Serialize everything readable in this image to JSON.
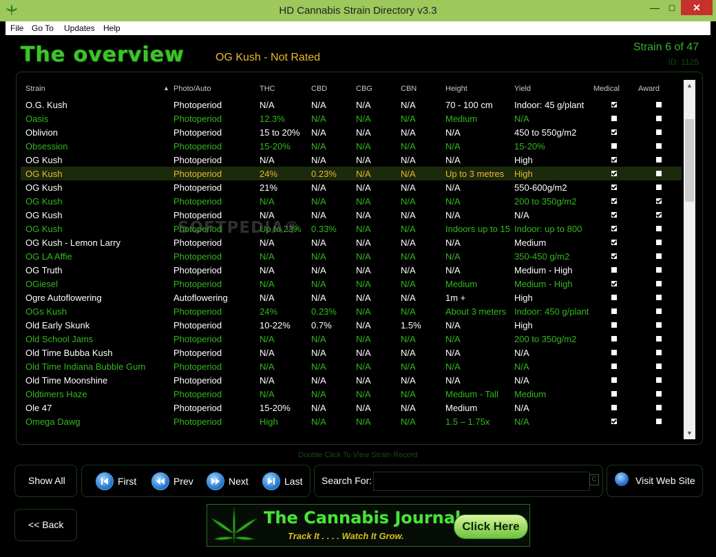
{
  "window": {
    "title": "HD Cannabis Strain Directory v3.3",
    "minimize": "—",
    "maximize": "□",
    "close": "✕"
  },
  "menu": [
    "File",
    "Go To",
    "Updates",
    "Help"
  ],
  "header": {
    "logo": "The overview",
    "selected_strain": "OG Kush - Not Rated",
    "counter": "Strain 6 of 47",
    "id": "ID: 1125"
  },
  "columns": [
    "Strain",
    "Photo/Auto",
    "THC",
    "CBD",
    "CBG",
    "CBN",
    "Height",
    "Yield",
    "Medical",
    "Award"
  ],
  "sort_indicator": "▲",
  "rows": [
    {
      "strain": "O.G. Kush",
      "photo": "Photoperiod",
      "thc": "N/A",
      "cbd": "N/A",
      "cbg": "N/A",
      "cbn": "N/A",
      "height": "70 - 100 cm",
      "yield": "Indoor: 45 g/plant",
      "medical": true,
      "award": false,
      "style": "white"
    },
    {
      "strain": "Oasis",
      "photo": "Photoperiod",
      "thc": "12.3%",
      "cbd": "N/A",
      "cbg": "N/A",
      "cbn": "N/A",
      "height": "Medium",
      "yield": "N/A",
      "medical": false,
      "award": false,
      "style": "green"
    },
    {
      "strain": "Oblivion",
      "photo": "Photoperiod",
      "thc": "15 to 20%",
      "cbd": "N/A",
      "cbg": "N/A",
      "cbn": "N/A",
      "height": "N/A",
      "yield": "450 to 550g/m2",
      "medical": true,
      "award": false,
      "style": "white"
    },
    {
      "strain": "Obsession",
      "photo": "Photoperiod",
      "thc": "15-20%",
      "cbd": "N/A",
      "cbg": "N/A",
      "cbn": "N/A",
      "height": "N/A",
      "yield": "15-20%",
      "medical": false,
      "award": false,
      "style": "green"
    },
    {
      "strain": "OG Kush",
      "photo": "Photoperiod",
      "thc": "N/A",
      "cbd": "N/A",
      "cbg": "N/A",
      "cbn": "N/A",
      "height": "N/A",
      "yield": "High",
      "medical": true,
      "award": false,
      "style": "white"
    },
    {
      "strain": "OG Kush",
      "photo": "Photoperiod",
      "thc": "24%",
      "cbd": "0.23%",
      "cbg": "N/A",
      "cbn": "N/A",
      "height": "Up to 3 metres",
      "yield": "High",
      "medical": true,
      "award": false,
      "style": "selected"
    },
    {
      "strain": "OG Kush",
      "photo": "Photoperiod",
      "thc": "21%",
      "cbd": "N/A",
      "cbg": "N/A",
      "cbn": "N/A",
      "height": "N/A",
      "yield": "550-600g/m2",
      "medical": true,
      "award": false,
      "style": "white"
    },
    {
      "strain": "OG Kush",
      "photo": "Photoperiod",
      "thc": "N/A",
      "cbd": "N/A",
      "cbg": "N/A",
      "cbn": "N/A",
      "height": "N/A",
      "yield": "200 to 350g/m2",
      "medical": true,
      "award": true,
      "style": "green"
    },
    {
      "strain": "OG Kush",
      "photo": "Photoperiod",
      "thc": "N/A",
      "cbd": "N/A",
      "cbg": "N/A",
      "cbn": "N/A",
      "height": "N/A",
      "yield": "N/A",
      "medical": true,
      "award": true,
      "style": "white"
    },
    {
      "strain": "OG Kush",
      "photo": "Photoperiod",
      "thc": "Up to 23%",
      "cbd": "0.33%",
      "cbg": "N/A",
      "cbn": "N/A",
      "height": "Indoors up to 15",
      "yield": "Indoor: up to 800",
      "medical": true,
      "award": false,
      "style": "green"
    },
    {
      "strain": "OG Kush - Lemon Larry",
      "photo": "Photoperiod",
      "thc": "N/A",
      "cbd": "N/A",
      "cbg": "N/A",
      "cbn": "N/A",
      "height": "N/A",
      "yield": "Medium",
      "medical": true,
      "award": false,
      "style": "white"
    },
    {
      "strain": "OG LA Affie",
      "photo": "Photoperiod",
      "thc": "N/A",
      "cbd": "N/A",
      "cbg": "N/A",
      "cbn": "N/A",
      "height": "N/A",
      "yield": "350-450 g/m2",
      "medical": true,
      "award": false,
      "style": "green"
    },
    {
      "strain": "OG Truth",
      "photo": "Photoperiod",
      "thc": "N/A",
      "cbd": "N/A",
      "cbg": "N/A",
      "cbn": "N/A",
      "height": "N/A",
      "yield": "Medium - High",
      "medical": false,
      "award": false,
      "style": "white"
    },
    {
      "strain": "OGiesel",
      "photo": "Photoperiod",
      "thc": "N/A",
      "cbd": "N/A",
      "cbg": "N/A",
      "cbn": "N/A",
      "height": "Medium",
      "yield": "Medium - High",
      "medical": true,
      "award": false,
      "style": "green"
    },
    {
      "strain": "Ogre Autoflowering",
      "photo": "Autoflowering",
      "thc": "N/A",
      "cbd": "N/A",
      "cbg": "N/A",
      "cbn": "N/A",
      "height": "1m +",
      "yield": "High",
      "medical": false,
      "award": false,
      "style": "white"
    },
    {
      "strain": "OGs Kush",
      "photo": "Photoperiod",
      "thc": "24%",
      "cbd": "0.23%",
      "cbg": "N/A",
      "cbn": "N/A",
      "height": "About 3 meters",
      "yield": "Indoor: 450 g/plant",
      "medical": false,
      "award": false,
      "style": "green"
    },
    {
      "strain": "Old Early Skunk",
      "photo": "Photoperiod",
      "thc": "10-22%",
      "cbd": "0.7%",
      "cbg": "N/A",
      "cbn": "1.5%",
      "height": "N/A",
      "yield": "High",
      "medical": false,
      "award": false,
      "style": "white"
    },
    {
      "strain": "Old School Jams",
      "photo": "Photoperiod",
      "thc": "N/A",
      "cbd": "N/A",
      "cbg": "N/A",
      "cbn": "N/A",
      "height": "N/A",
      "yield": "200 to 350g/m2",
      "medical": false,
      "award": false,
      "style": "green"
    },
    {
      "strain": "Old Time Bubba Kush",
      "photo": "Photoperiod",
      "thc": "N/A",
      "cbd": "N/A",
      "cbg": "N/A",
      "cbn": "N/A",
      "height": "N/A",
      "yield": "N/A",
      "medical": false,
      "award": false,
      "style": "white"
    },
    {
      "strain": "Old Time Indiana Bubble Gum",
      "photo": "Photoperiod",
      "thc": "N/A",
      "cbd": "N/A",
      "cbg": "N/A",
      "cbn": "N/A",
      "height": "N/A",
      "yield": "N/A",
      "medical": false,
      "award": false,
      "style": "green"
    },
    {
      "strain": "Old Time Moonshine",
      "photo": "Photoperiod",
      "thc": "N/A",
      "cbd": "N/A",
      "cbg": "N/A",
      "cbn": "N/A",
      "height": "N/A",
      "yield": "N/A",
      "medical": false,
      "award": false,
      "style": "white"
    },
    {
      "strain": "Oldtimers Haze",
      "photo": "Photoperiod",
      "thc": "N/A",
      "cbd": "N/A",
      "cbg": "N/A",
      "cbn": "N/A",
      "height": "Medium - Tall",
      "yield": "Medium",
      "medical": false,
      "award": false,
      "style": "green"
    },
    {
      "strain": "Ole 47",
      "photo": "Photoperiod",
      "thc": "15-20%",
      "cbd": "N/A",
      "cbg": "N/A",
      "cbn": "N/A",
      "height": "Medium",
      "yield": "N/A",
      "medical": false,
      "award": false,
      "style": "white"
    },
    {
      "strain": "Omega Dawg",
      "photo": "Photoperiod",
      "thc": "High",
      "cbd": "N/A",
      "cbg": "N/A",
      "cbn": "N/A",
      "height": "1.5 – 1.75x",
      "yield": "N/A",
      "medical": true,
      "award": false,
      "style": "green"
    }
  ],
  "watermark": "SOFTPEDIA®",
  "hint": "Double Click To View Strain Record",
  "buttons": {
    "show_all": "Show All",
    "first": "First",
    "prev": "Prev",
    "next": "Next",
    "last": "Last",
    "search_label": "Search For:",
    "search_value": "",
    "clear": "C",
    "visit": "Visit Web Site",
    "back": "<< Back"
  },
  "banner": {
    "title": "The Cannabis Journal",
    "subtitle": "Track It . . . .   Watch It Grow.",
    "cta": "Click Here"
  }
}
